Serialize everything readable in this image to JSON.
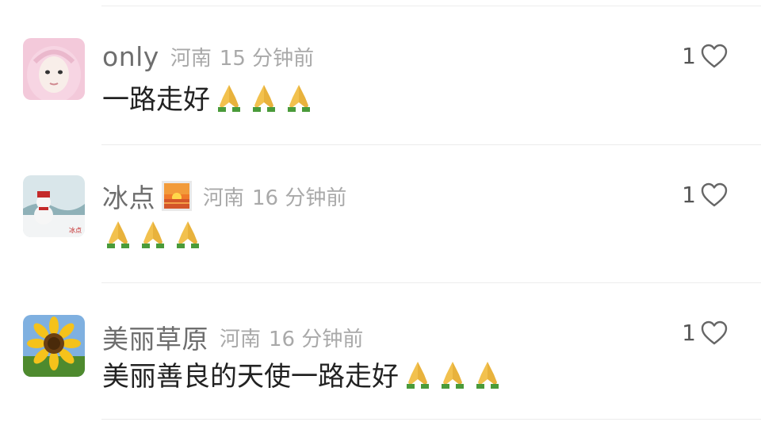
{
  "comments": [
    {
      "username": "only",
      "location": "河南",
      "time": "15 分钟前",
      "text": "一路走好",
      "emoji_icon": "folded-hands-icon",
      "emoji_count": 3,
      "likes": "1"
    },
    {
      "username": "冰点",
      "badge_icon": "sunset-icon",
      "location": "河南",
      "time": "16 分钟前",
      "text": "",
      "emoji_icon": "folded-hands-icon",
      "emoji_count": 3,
      "likes": "1"
    },
    {
      "username": "美丽草原",
      "location": "河南",
      "time": "16 分钟前",
      "text": "美丽善良的天使一路走好",
      "emoji_icon": "folded-hands-icon",
      "emoji_count": 3,
      "likes": "1"
    }
  ],
  "colors": {
    "username": "#6e6e6e",
    "meta": "#a9a9a9",
    "text": "#222222",
    "divider": "#ececec"
  }
}
